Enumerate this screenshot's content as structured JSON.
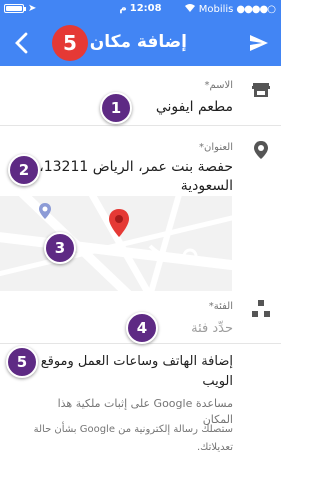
{
  "status_bar": {
    "carrier": "Mobilis",
    "time": "12:08",
    "period": "م"
  },
  "appbar": {
    "title": "إضافة مكان",
    "back_icon": "chevron-left-icon",
    "send_icon": "send-icon"
  },
  "annotations": {
    "title_marker": "5",
    "name_marker": "1",
    "address_marker": "2",
    "map_marker": "3",
    "category_marker": "4",
    "details_marker": "5"
  },
  "form": {
    "name_label": "الاسم*",
    "name_value": "مطعم ايفوني",
    "address_label": "العنوان*",
    "address_line1": "حفصة بنت عمر، الرياض 13211،",
    "address_line2": "السعودية",
    "category_label": "الفئة*",
    "category_placeholder": "حدِّد فئة",
    "details_line1": "إضافة الهاتف وساعات العمل وموقع",
    "details_line2": "الويب",
    "details_hint_line1": "مساعدة Google على إثبات ملكية هذا",
    "details_hint_line2": "المكان",
    "email_hint_line1": "ستصلك رسالة إلكترونية من Google بشأن حالة",
    "email_hint_line2": "تعديلاتك."
  },
  "colors": {
    "brand_blue": "#4285f4",
    "marker_red": "#e53935",
    "annotation_purple": "#5e2a84"
  }
}
